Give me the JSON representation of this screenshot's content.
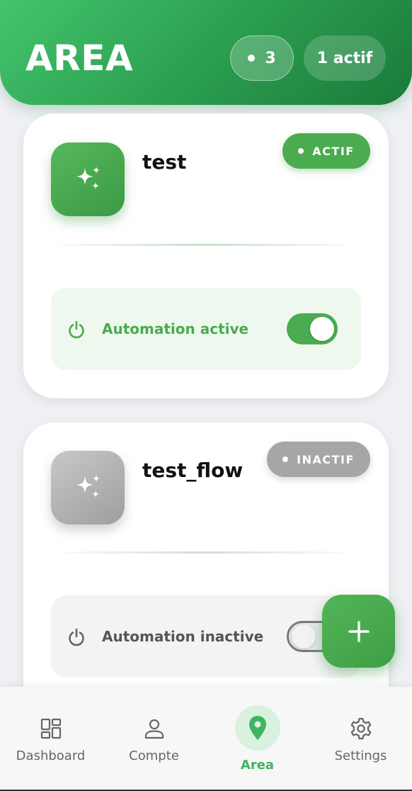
{
  "header": {
    "title": "AREA",
    "count_badge": "3",
    "active_badge": "1 actif"
  },
  "cards": [
    {
      "name": "test",
      "status": "ACTIF",
      "automation_label": "Automation active",
      "toggle_on": true,
      "icon": "sparkles-icon"
    },
    {
      "name": "test_flow",
      "status": "INACTIF",
      "automation_label": "Automation inactive",
      "toggle_on": false,
      "icon": "sparkles-icon"
    }
  ],
  "fab": {
    "icon": "plus-icon"
  },
  "bottom_nav": {
    "items": [
      {
        "label": "Dashboard",
        "icon": "dashboard-icon",
        "active": false
      },
      {
        "label": "Compte",
        "icon": "user-icon",
        "active": false
      },
      {
        "label": "Area",
        "icon": "location-pin-icon",
        "active": true
      },
      {
        "label": "Settings",
        "icon": "gear-icon",
        "active": false
      }
    ]
  },
  "colors": {
    "accent": "#4aab4f",
    "header_gradient_start": "#43c46c",
    "header_gradient_end": "#1a7a3a",
    "inactive_gray": "#a6a6a6",
    "nav_active": "#3fb561"
  }
}
